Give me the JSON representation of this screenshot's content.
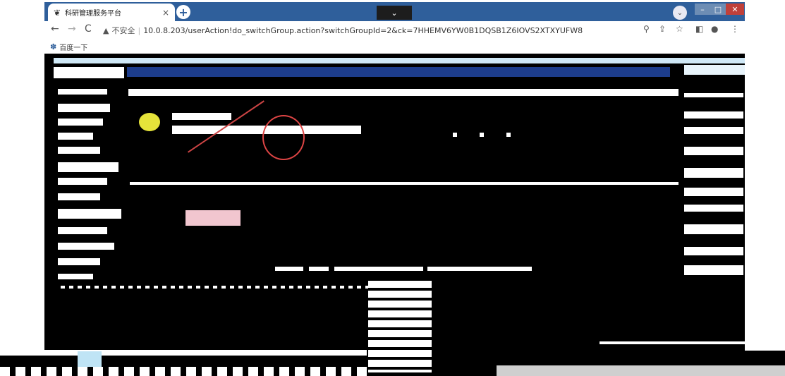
{
  "browser": {
    "tab_title": "科研管理服务平台",
    "tab_close": "×",
    "new_tab": "+",
    "tab_dropdown": "⌄",
    "window_controls": {
      "minimize": "–",
      "maximize": "□",
      "close": "✕"
    },
    "nav": {
      "back": "←",
      "forward": "→",
      "reload": "C"
    },
    "security_label": "不安全",
    "url": "10.0.8.203/userAction!do_switchGroup.action?switchGroupId=2&ck=7HHEMV6YW0B1DQSB1Z6IOVS2XTXYUFW8",
    "bookmark": "百度一下"
  },
  "icons": {
    "tab_favicon": "logo-icon",
    "warning": "warning-icon",
    "zoom": "zoom-icon",
    "share": "share-icon",
    "star": "star-icon",
    "sidebar": "sidepanel-icon",
    "profile": "profile-icon",
    "menu": "menu-icon",
    "bookmark_favicon": "baidu-icon"
  },
  "colors": {
    "tabstrip": "#2f5f9b",
    "navband": "#1d3d8c",
    "annotation": "#d44444",
    "highlight": "#e5e33a"
  }
}
